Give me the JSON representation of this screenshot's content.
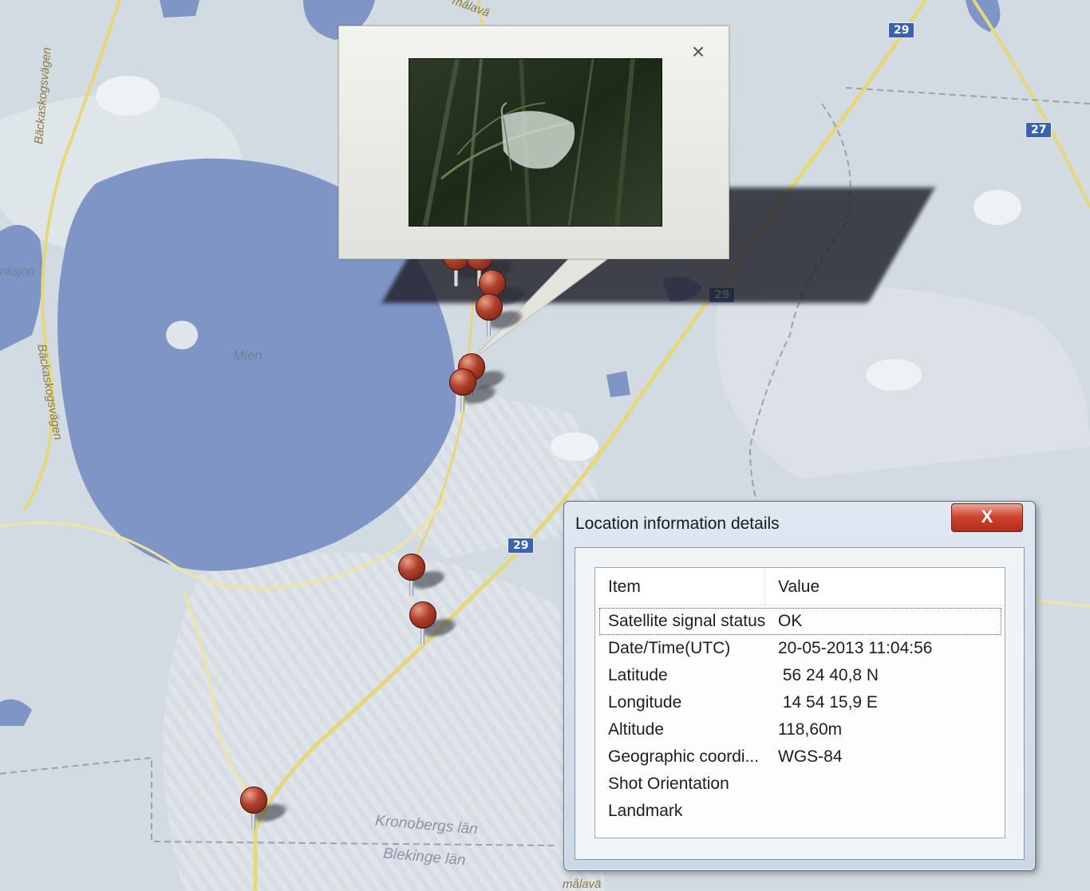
{
  "map": {
    "lake_label": "Mien",
    "lake_label_left": "nksjön",
    "road_label_1": "Bäckaskogsvägen",
    "road_label_2": "Bäckaskogsvägen",
    "road_label_top": "målavä",
    "road_label_bottom": "målavä",
    "county_label_1": "Kronobergs län",
    "county_label_2": "Blekinge län",
    "shields": [
      "29",
      "27",
      "29",
      "29"
    ]
  },
  "callout": {
    "close_glyph": "×"
  },
  "dialog": {
    "title": "Location information details",
    "close_glyph": "X",
    "columns": {
      "item": "Item",
      "value": "Value"
    },
    "rows": [
      {
        "item": "Satellite signal status",
        "value": "OK"
      },
      {
        "item": "Date/Time(UTC)",
        "value": "20-05-2013 11:04:56"
      },
      {
        "item": "Latitude",
        "value": " 56 24 40,8 N"
      },
      {
        "item": "Longitude",
        "value": " 14 54 15,9 E"
      },
      {
        "item": "Altitude",
        "value": "118,60m"
      },
      {
        "item": "Geographic coordi...",
        "value": "WGS-84"
      },
      {
        "item": "Shot Orientation",
        "value": ""
      },
      {
        "item": "Landmark",
        "value": ""
      }
    ]
  },
  "colors": {
    "lake": "#7e95c6",
    "land": "#d3dbe2",
    "road_major": "#e5d77a",
    "pin": "#b0402c",
    "dialog_close": "#d0452f"
  },
  "icons": [
    "close-icon",
    "map-pin-icon"
  ]
}
